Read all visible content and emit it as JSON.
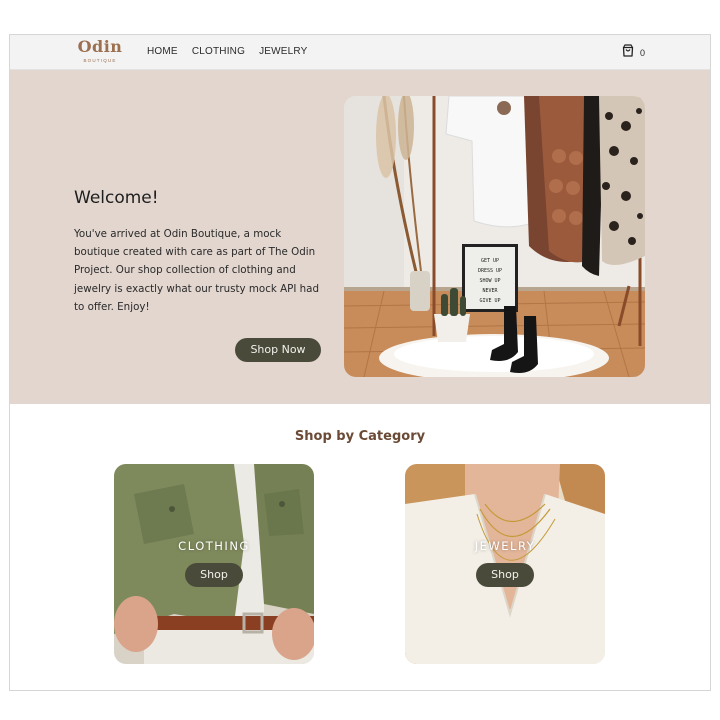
{
  "nav": {
    "logo_main": "Odin",
    "logo_sub": "BOUTIQUE",
    "links": [
      {
        "label": "HOME"
      },
      {
        "label": "CLOTHING"
      },
      {
        "label": "JEWELRY"
      }
    ],
    "cart_count": "0",
    "cart_icon": "shopping-bag-icon"
  },
  "hero": {
    "title": "Welcome!",
    "text": "You've arrived at Odin Boutique, a mock boutique created with care as part of The Odin Project. Our shop collection of clothing and jewelry is exactly what our trusty mock API had to offer. Enjoy!",
    "cta_label": "Shop Now",
    "letterboard": [
      "GET UP",
      "DRESS UP",
      "SHOW UP",
      "NEVER",
      "GIVE UP"
    ]
  },
  "categories": {
    "heading": "Shop by Category",
    "items": [
      {
        "title": "CLOTHING",
        "button_label": "Shop"
      },
      {
        "title": "JEWELRY",
        "button_label": "Shop"
      }
    ]
  },
  "colors": {
    "hero_bg": "#e2d6cf",
    "button_bg": "#4a4a3b",
    "brand": "#9b6f4f",
    "heading_brown": "#6b4a36"
  }
}
